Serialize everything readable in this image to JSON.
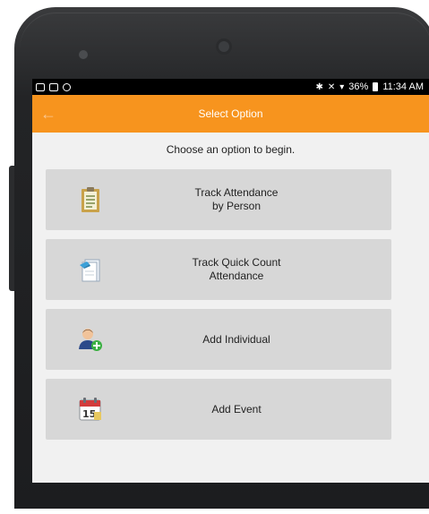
{
  "status_bar": {
    "left_icons": [
      "notification-square-icon",
      "notification-photo-icon",
      "notification-camera-icon"
    ],
    "right_icons": [
      "bluetooth-icon",
      "mute-icon",
      "wifi-icon",
      "battery-icon"
    ],
    "battery": "36%",
    "time": "11:34 AM"
  },
  "app_bar": {
    "title": "Select Option",
    "back_icon": "back-arrow-icon",
    "color": "#f7941e"
  },
  "prompt": "Choose an option to begin.",
  "options": [
    {
      "line1": "Track Attendance",
      "line2": "by Person",
      "icon": "clipboard-icon"
    },
    {
      "line1": "Track Quick Count",
      "line2": "Attendance",
      "icon": "document-icon"
    },
    {
      "line1": "Add Individual",
      "line2": "",
      "icon": "add-person-icon"
    },
    {
      "line1": "Add Event",
      "line2": "",
      "icon": "calendar-icon"
    }
  ],
  "calendar_day": "15"
}
